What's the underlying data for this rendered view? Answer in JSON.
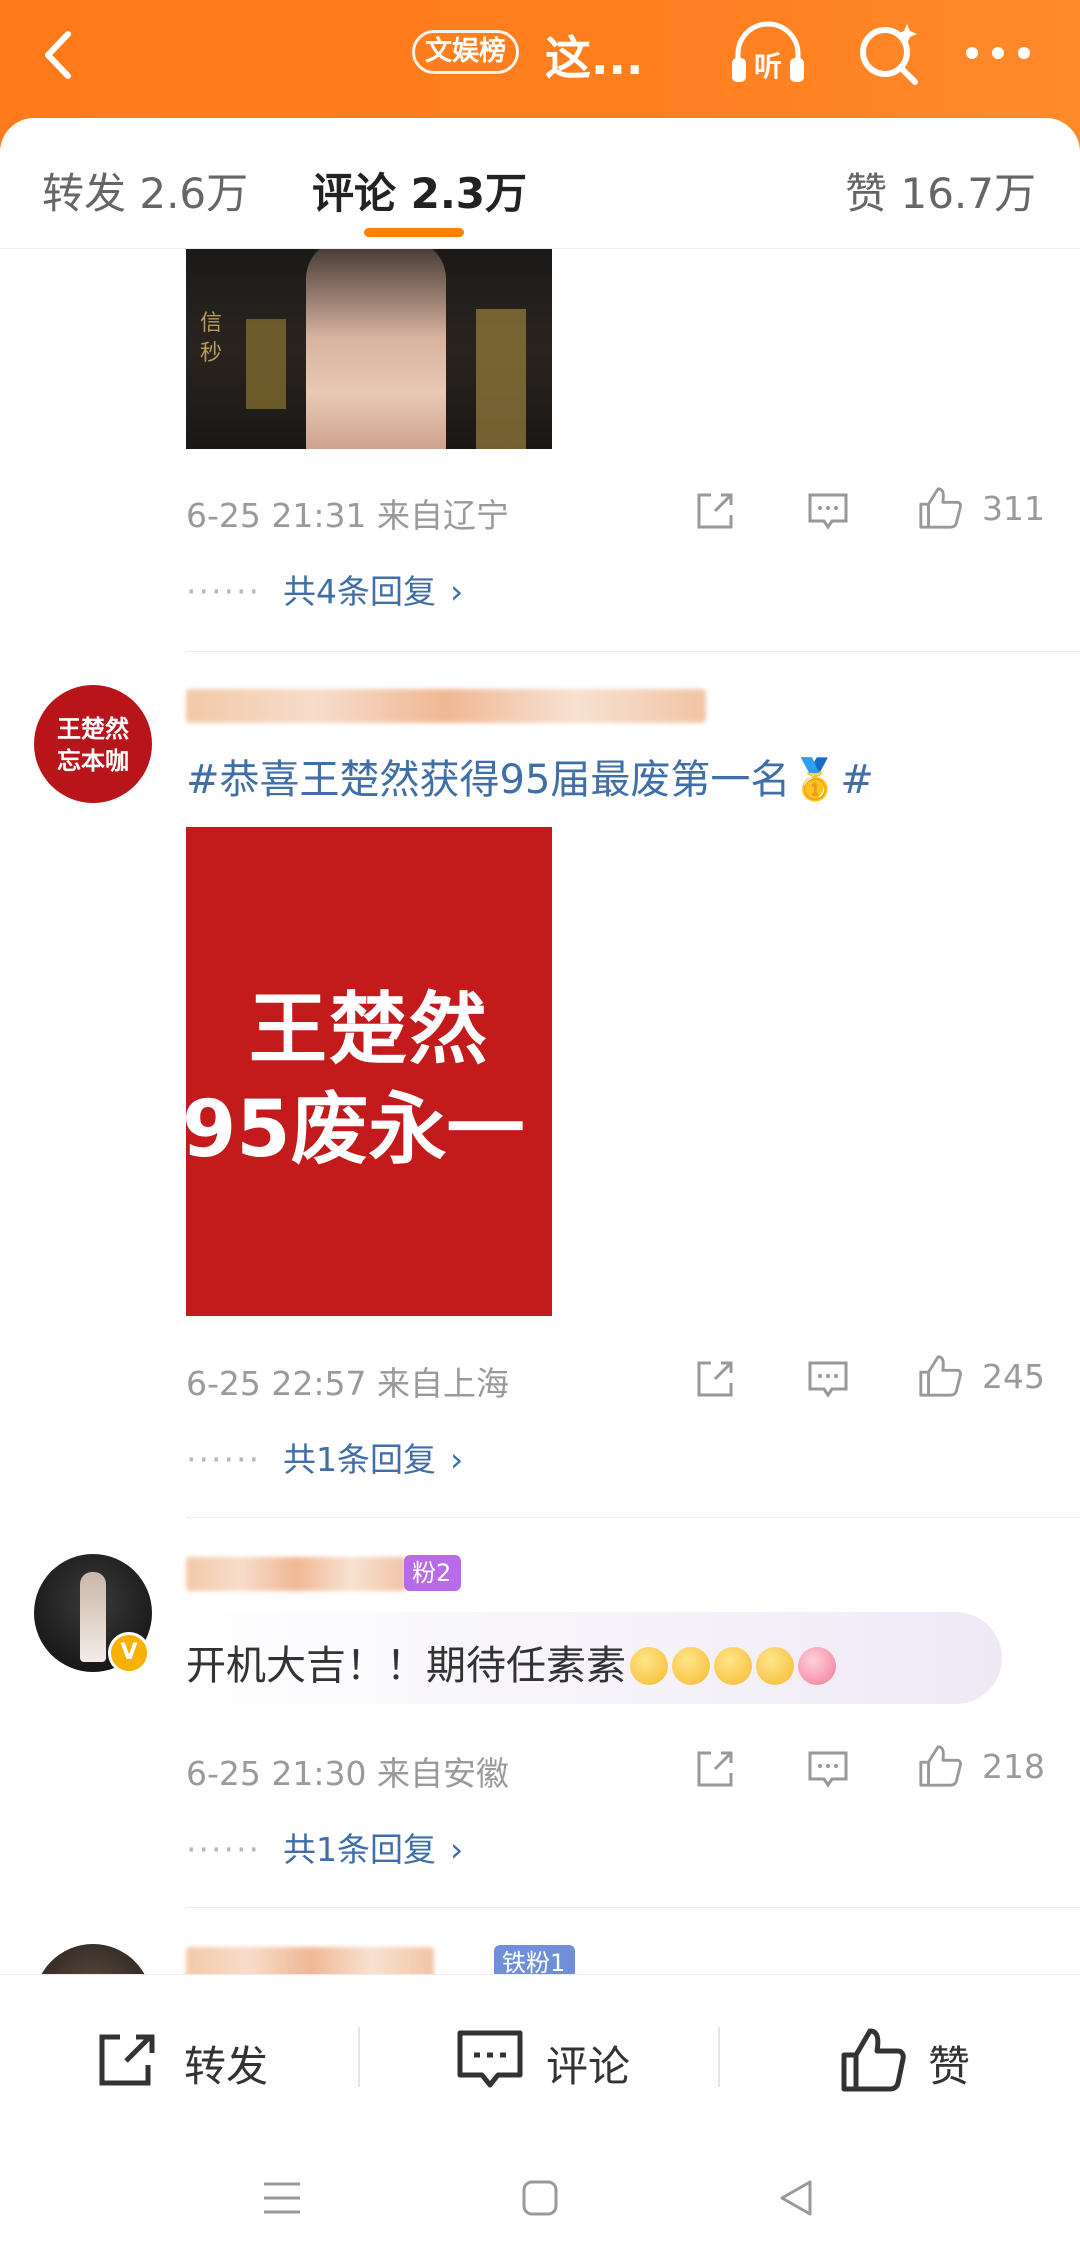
{
  "header": {
    "rank_badge": "文娱榜",
    "title": "这..."
  },
  "tabs": {
    "repost": "转发 2.6万",
    "comment": "评论 2.3万",
    "like": "赞 16.7万"
  },
  "comments": [
    {
      "meta": "6-25 21:31 来自辽宁",
      "likes": "311",
      "replies": "共4条回复",
      "image_text_vertical": "信 秒"
    },
    {
      "avatar_text": [
        "王楚然",
        "忘本咖"
      ],
      "text": "#恭喜王楚然获得95届最废第一名🥇#",
      "image_text": [
        "王楚然",
        "95废永一"
      ],
      "meta": "6-25 22:57 来自上海",
      "likes": "245",
      "replies": "共1条回复"
    },
    {
      "fan_badge": "粉2",
      "text": "开机大吉！！期待任素素",
      "meta": "6-25 21:30 来自安徽",
      "likes": "218",
      "replies": "共1条回复"
    },
    {
      "fan_badge": "铁粉1"
    }
  ],
  "bottom_bar": {
    "repost": "转发",
    "comment": "评论",
    "like": "赞"
  },
  "reply_dots": "······",
  "colors": {
    "brand_orange": "#ff7a1a",
    "link_blue": "#3f6ea8",
    "tab_underline": "#ff8200"
  }
}
